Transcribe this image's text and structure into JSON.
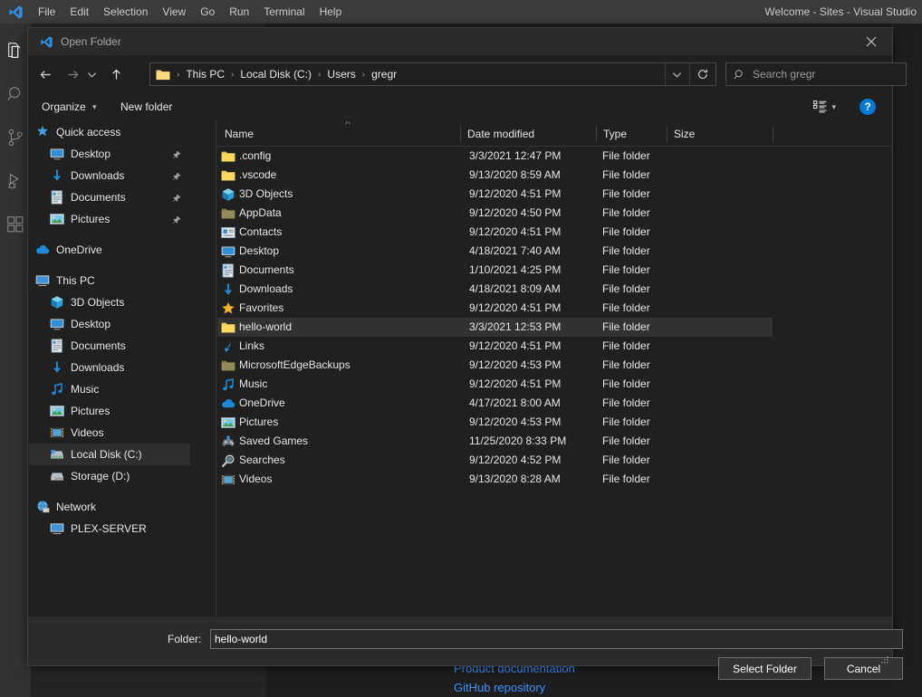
{
  "vscode": {
    "logo_icon": "vscode-logo-icon",
    "menu": [
      {
        "label": "File"
      },
      {
        "label": "Edit"
      },
      {
        "label": "Selection"
      },
      {
        "label": "View"
      },
      {
        "label": "Go"
      },
      {
        "label": "Run"
      },
      {
        "label": "Terminal"
      },
      {
        "label": "Help"
      }
    ],
    "window_title": "Welcome - Sites - Visual Studio",
    "activity_bar": [
      {
        "name": "explorer-icon"
      },
      {
        "name": "search-icon"
      },
      {
        "name": "source-control-icon"
      },
      {
        "name": "run-and-debug-icon"
      },
      {
        "name": "extensions-icon"
      }
    ],
    "welcome_links": [
      {
        "label": "Product documentation"
      },
      {
        "label": "GitHub repository"
      }
    ]
  },
  "dialog": {
    "title": "Open Folder",
    "title_icon": "vscode-logo-icon",
    "close_icon": "close-icon",
    "nav": {
      "back_icon": "arrow-left-icon",
      "forward_icon": "arrow-right-icon",
      "recent_icon": "chevron-down-icon",
      "up_icon": "arrow-up-icon",
      "history_icon": "chevron-down-icon",
      "refresh_icon": "refresh-icon"
    },
    "breadcrumb": {
      "folder_icon": "folder-icon",
      "separator": "›",
      "items": [
        "This PC",
        "Local Disk (C:)",
        "Users",
        "gregr"
      ]
    },
    "search": {
      "icon": "search-icon",
      "placeholder": "Search gregr",
      "value": ""
    },
    "commandbar": {
      "organize_label": "Organize",
      "organize_caret": "▾",
      "new_folder_label": "New folder",
      "view_icon": "view-list-icon",
      "view_caret": "▾",
      "help_label": "?"
    },
    "navpane": [
      {
        "label": "Quick access",
        "icon": "star-pin-icon",
        "indent": 6,
        "pinned": false,
        "selected": false
      },
      {
        "label": "Desktop",
        "icon": "desktop-icon",
        "indent": 22,
        "pinned": true,
        "selected": false
      },
      {
        "label": "Downloads",
        "icon": "downloads-icon",
        "indent": 22,
        "pinned": true,
        "selected": false
      },
      {
        "label": "Documents",
        "icon": "documents-icon",
        "indent": 22,
        "pinned": true,
        "selected": false
      },
      {
        "label": "Pictures",
        "icon": "pictures-icon",
        "indent": 22,
        "pinned": true,
        "selected": false
      },
      {
        "gap": true
      },
      {
        "label": "OneDrive",
        "icon": "cloud-icon",
        "indent": 6,
        "pinned": false,
        "selected": false
      },
      {
        "gap": true
      },
      {
        "label": "This PC",
        "icon": "computer-icon",
        "indent": 6,
        "pinned": false,
        "selected": false
      },
      {
        "label": "3D Objects",
        "icon": "3d-objects-icon",
        "indent": 22,
        "pinned": false,
        "selected": false
      },
      {
        "label": "Desktop",
        "icon": "desktop-icon",
        "indent": 22,
        "pinned": false,
        "selected": false
      },
      {
        "label": "Documents",
        "icon": "documents-icon",
        "indent": 22,
        "pinned": false,
        "selected": false
      },
      {
        "label": "Downloads",
        "icon": "downloads-icon",
        "indent": 22,
        "pinned": false,
        "selected": false
      },
      {
        "label": "Music",
        "icon": "music-icon",
        "indent": 22,
        "pinned": false,
        "selected": false
      },
      {
        "label": "Pictures",
        "icon": "pictures-icon",
        "indent": 22,
        "pinned": false,
        "selected": false
      },
      {
        "label": "Videos",
        "icon": "videos-icon",
        "indent": 22,
        "pinned": false,
        "selected": false
      },
      {
        "label": "Local Disk (C:)",
        "icon": "disk-system-icon",
        "indent": 22,
        "pinned": false,
        "selected": true
      },
      {
        "label": "Storage (D:)",
        "icon": "disk-icon",
        "indent": 22,
        "pinned": false,
        "selected": false
      },
      {
        "gap": true
      },
      {
        "label": "Network",
        "icon": "network-icon",
        "indent": 6,
        "pinned": false,
        "selected": false
      },
      {
        "label": "PLEX-SERVER",
        "icon": "computer-icon",
        "indent": 22,
        "pinned": false,
        "selected": false
      }
    ],
    "filelist": {
      "columns": [
        {
          "label": "Name",
          "sorted": "asc",
          "sort_glyph": "˄"
        },
        {
          "label": "Date modified"
        },
        {
          "label": "Type"
        },
        {
          "label": "Size"
        }
      ],
      "rows": [
        {
          "name": ".config",
          "date": "3/3/2021 12:47 PM",
          "type": "File folder",
          "size": "",
          "icon": "folder-icon",
          "selected": false
        },
        {
          "name": ".vscode",
          "date": "9/13/2020 8:59 AM",
          "type": "File folder",
          "size": "",
          "icon": "folder-icon",
          "selected": false
        },
        {
          "name": "3D Objects",
          "date": "9/12/2020 4:51 PM",
          "type": "File folder",
          "size": "",
          "icon": "3d-objects-icon",
          "selected": false
        },
        {
          "name": "AppData",
          "date": "9/12/2020 4:50 PM",
          "type": "File folder",
          "size": "",
          "icon": "folder-hidden-icon",
          "selected": false
        },
        {
          "name": "Contacts",
          "date": "9/12/2020 4:51 PM",
          "type": "File folder",
          "size": "",
          "icon": "contacts-icon",
          "selected": false
        },
        {
          "name": "Desktop",
          "date": "4/18/2021 7:40 AM",
          "type": "File folder",
          "size": "",
          "icon": "desktop-icon",
          "selected": false
        },
        {
          "name": "Documents",
          "date": "1/10/2021 4:25 PM",
          "type": "File folder",
          "size": "",
          "icon": "documents-icon",
          "selected": false
        },
        {
          "name": "Downloads",
          "date": "4/18/2021 8:09 AM",
          "type": "File folder",
          "size": "",
          "icon": "downloads-icon",
          "selected": false
        },
        {
          "name": "Favorites",
          "date": "9/12/2020 4:51 PM",
          "type": "File folder",
          "size": "",
          "icon": "star-icon",
          "selected": false
        },
        {
          "name": "hello-world",
          "date": "3/3/2021 12:53 PM",
          "type": "File folder",
          "size": "",
          "icon": "folder-icon",
          "selected": true
        },
        {
          "name": "Links",
          "date": "9/12/2020 4:51 PM",
          "type": "File folder",
          "size": "",
          "icon": "links-icon",
          "selected": false
        },
        {
          "name": "MicrosoftEdgeBackups",
          "date": "9/12/2020 4:53 PM",
          "type": "File folder",
          "size": "",
          "icon": "folder-hidden-icon",
          "selected": false
        },
        {
          "name": "Music",
          "date": "9/12/2020 4:51 PM",
          "type": "File folder",
          "size": "",
          "icon": "music-icon",
          "selected": false
        },
        {
          "name": "OneDrive",
          "date": "4/17/2021 8:00 AM",
          "type": "File folder",
          "size": "",
          "icon": "cloud-icon",
          "selected": false
        },
        {
          "name": "Pictures",
          "date": "9/12/2020 4:53 PM",
          "type": "File folder",
          "size": "",
          "icon": "pictures-icon",
          "selected": false
        },
        {
          "name": "Saved Games",
          "date": "11/25/2020 8:33 PM",
          "type": "File folder",
          "size": "",
          "icon": "saved-games-icon",
          "selected": false
        },
        {
          "name": "Searches",
          "date": "9/12/2020 4:52 PM",
          "type": "File folder",
          "size": "",
          "icon": "searches-icon",
          "selected": false
        },
        {
          "name": "Videos",
          "date": "9/13/2020 8:28 AM",
          "type": "File folder",
          "size": "",
          "icon": "videos-icon",
          "selected": false
        }
      ]
    },
    "footer": {
      "folder_label": "Folder:",
      "folder_value": "hello-world",
      "folder_placeholder": "",
      "select_label": "Select Folder",
      "cancel_label": "Cancel",
      "resize_grip_icon": "resize-grip-icon"
    }
  },
  "colors": {
    "accent": "#0078d4",
    "folder_yellow": "#ffd95c",
    "dialog_bg": "#202020",
    "titlebar_bg": "#2b2b2b",
    "selection_bg": "#323232",
    "link_blue": "#3794ff"
  }
}
